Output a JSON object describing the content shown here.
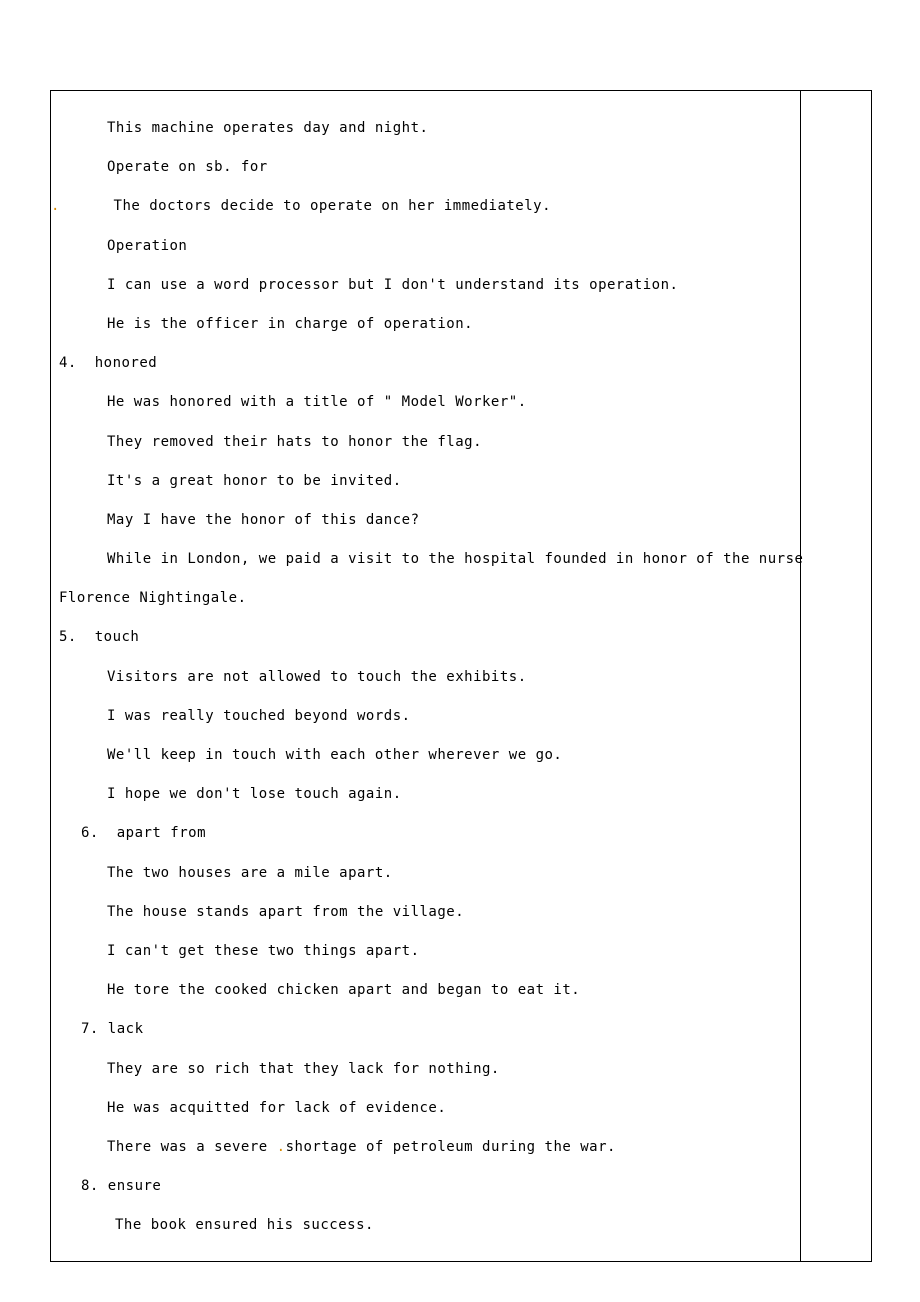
{
  "lines": {
    "l1": "This machine operates day and night.",
    "l2": "Operate on sb. for",
    "l3": "The doctors decide to operate on her immediately.",
    "l4": "Operation",
    "l5": "I can use a word processor but I don't understand its operation.",
    "l6": "He is the officer in charge of operation.",
    "l7": "4.  honored",
    "l8": "He was honored with a title of \" Model Worker\".",
    "l9": "They removed their hats to honor the flag.",
    "l10": "It's a great honor to be invited.",
    "l11": "May I have the honor of this dance?",
    "l12": "While in London, we paid a visit to the hospital founded in honor of the nurse",
    "l13": "Florence Nightingale.",
    "l14": "5.  touch",
    "l15": "Visitors are not allowed to touch the exhibits.",
    "l16": "I was really touched beyond words.",
    "l17": "We'll keep in touch with each other wherever we go.",
    "l18": "I hope we don't lose touch again.",
    "l19": "6.  apart from",
    "l20": "The two houses are a mile apart.",
    "l21": "The house stands apart from the village.",
    "l22": "I can't get these two things apart.",
    "l23": "He tore the cooked chicken apart and began to eat it.",
    "l24": "7. lack",
    "l25": "They are so rich that they lack for nothing.",
    "l26": "He was acquitted for lack of evidence.",
    "l27a": "There was a severe ",
    "l27b": "shortage of petroleum during the war.",
    "l28": "8. ensure",
    "l29": "The book ensured his success."
  }
}
